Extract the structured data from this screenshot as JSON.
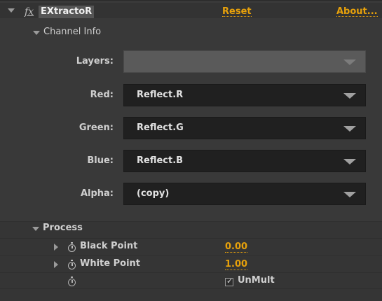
{
  "effect": {
    "fx_label": "fx",
    "name": "EXtractoR",
    "reset_label": "Reset",
    "about_label": "About..."
  },
  "channel_info": {
    "title": "Channel Info",
    "rows": [
      {
        "label": "Layers:",
        "value": "",
        "enabled": false
      },
      {
        "label": "Red:",
        "value": "Reflect.R",
        "enabled": true
      },
      {
        "label": "Green:",
        "value": "Reflect.G",
        "enabled": true
      },
      {
        "label": "Blue:",
        "value": "Reflect.B",
        "enabled": true
      },
      {
        "label": "Alpha:",
        "value": "(copy)",
        "enabled": true
      }
    ]
  },
  "process": {
    "title": "Process",
    "black_point": {
      "label": "Black Point",
      "value": "0.00"
    },
    "white_point": {
      "label": "White Point",
      "value": "1.00"
    },
    "unmult": {
      "label": "UnMult",
      "checked": true
    }
  },
  "colors": {
    "accent": "#e7a10b",
    "panel_bg": "#393939",
    "dropdown_bg": "#202020"
  },
  "icons": [
    "disclosure-triangle-icon",
    "stopwatch-icon",
    "dropdown-arrow-icon",
    "checkbox-icon"
  ]
}
